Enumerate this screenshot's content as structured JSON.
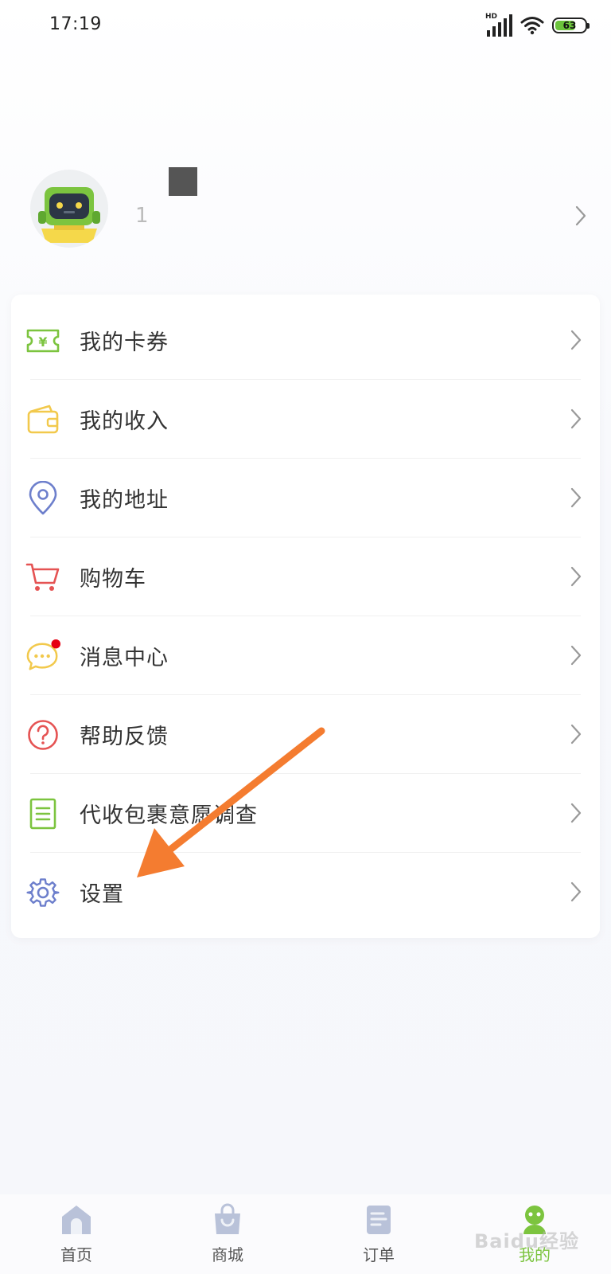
{
  "status_bar": {
    "time": "17:19",
    "signal_label": "HD",
    "battery": "63"
  },
  "profile": {
    "name_partial": "1",
    "avatar": "robot-avatar-icon"
  },
  "menu": {
    "items": [
      {
        "label": "我的卡券",
        "icon": "coupon-icon",
        "color": "#7cc43f"
      },
      {
        "label": "我的收入",
        "icon": "wallet-icon",
        "color": "#f2c94c"
      },
      {
        "label": "我的地址",
        "icon": "location-pin-icon",
        "color": "#6d7fcc"
      },
      {
        "label": "购物车",
        "icon": "cart-icon",
        "color": "#e55353"
      },
      {
        "label": "消息中心",
        "icon": "message-icon",
        "color": "#f2c94c"
      },
      {
        "label": "帮助反馈",
        "icon": "help-icon",
        "color": "#e55353"
      },
      {
        "label": "代收包裹意愿调查",
        "icon": "survey-icon",
        "color": "#7cc43f"
      },
      {
        "label": "设置",
        "icon": "gear-icon",
        "color": "#6d7fcc"
      }
    ]
  },
  "tabs": [
    {
      "label": "首页",
      "icon": "home-icon"
    },
    {
      "label": "商城",
      "icon": "shopping-bag-icon"
    },
    {
      "label": "订单",
      "icon": "order-icon"
    },
    {
      "label": "我的",
      "icon": "profile-icon",
      "active": true
    }
  ],
  "colors": {
    "accent": "#7cc43f",
    "arrow": "#f47c30",
    "badge": "#e60012"
  },
  "watermark": "Baidu经验"
}
